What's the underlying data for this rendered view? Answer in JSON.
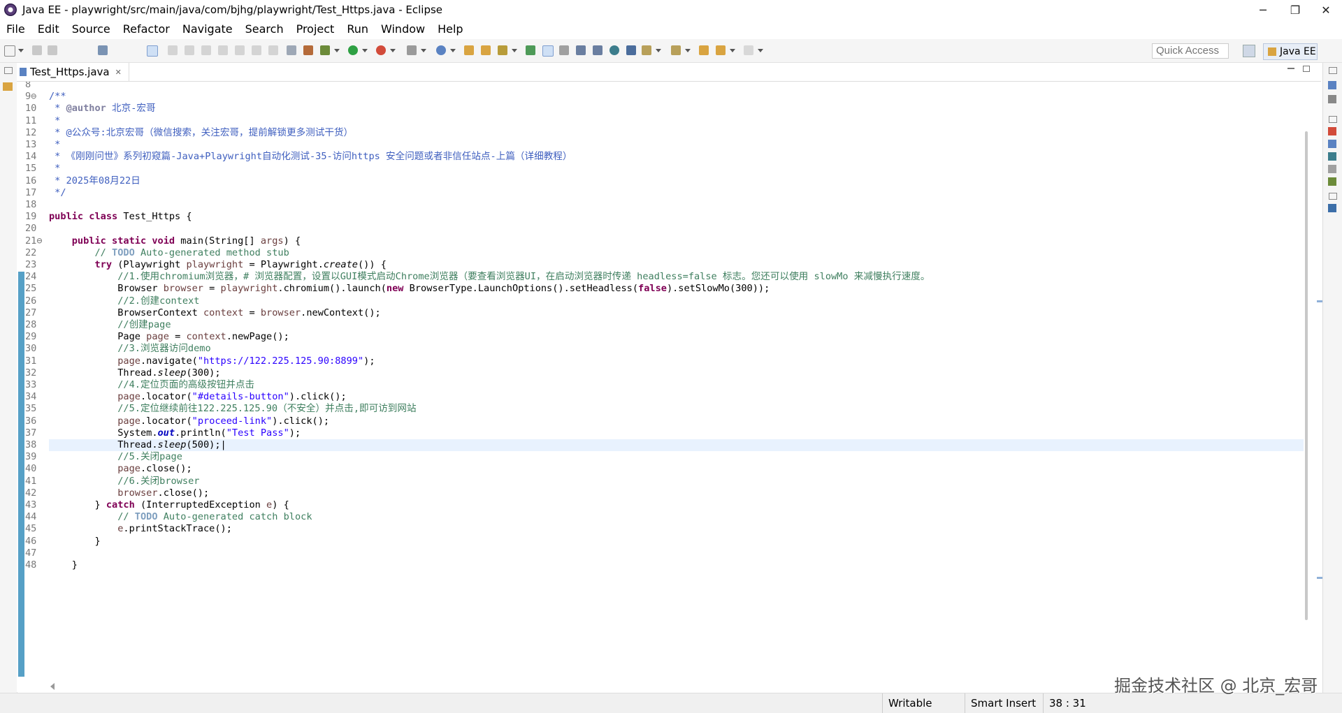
{
  "window": {
    "title": "Java EE - playwright/src/main/java/com/bjhg/playwright/Test_Https.java - Eclipse",
    "minimize_glyph": "─",
    "restore_glyph": "❐",
    "close_glyph": "✕"
  },
  "menu": [
    "File",
    "Edit",
    "Source",
    "Refactor",
    "Navigate",
    "Search",
    "Project",
    "Run",
    "Window",
    "Help"
  ],
  "toolbar": {
    "quick_access_placeholder": "Quick Access",
    "perspective_label": "Java EE"
  },
  "editor_tab": {
    "label": "Test_Https.java",
    "close_glyph": "✕"
  },
  "code_lines": [
    {
      "n": "8",
      "html": ""
    },
    {
      "n": "9⊖",
      "html": "<span class='jd'>/**</span>"
    },
    {
      "n": "10",
      "html": "<span class='jd'> * <span class='ann'>@author</span> 北京-宏哥</span>"
    },
    {
      "n": "11",
      "html": "<span class='jd'> *</span>"
    },
    {
      "n": "12",
      "html": "<span class='jd'> * @公众号:北京宏哥（微信搜索，关注宏哥，提前解锁更多测试干货）</span>"
    },
    {
      "n": "13",
      "html": "<span class='jd'> *</span>"
    },
    {
      "n": "14",
      "html": "<span class='jd'> * 《刚刚问世》系列初窥篇-Java+Playwright自动化测试-35-访问https 安全问题或者非信任站点-上篇（详细教程）</span>"
    },
    {
      "n": "15",
      "html": "<span class='jd'> *</span>"
    },
    {
      "n": "16",
      "html": "<span class='jd'> * 2025年08月22日</span>"
    },
    {
      "n": "17",
      "html": "<span class='jd'> */</span>"
    },
    {
      "n": "18",
      "html": ""
    },
    {
      "n": "19",
      "html": "<span class='kw'>public class</span> Test_Https {"
    },
    {
      "n": "20",
      "html": ""
    },
    {
      "n": "21⊖",
      "html": "    <span class='kw'>public static void</span> main(String[] <span class='var'>args</span>) {"
    },
    {
      "n": "22",
      "html": "        <span class='cm'>// <span class='todo'>TODO</span> Auto-generated method stub</span>"
    },
    {
      "n": "23",
      "html": "        <span class='kw'>try</span> (Playwright <span class='var'>playwright</span> = Playwright.<span class='it'>create</span>()) {"
    },
    {
      "n": "24",
      "html": "            <span class='cm'>//1.使用chromium浏览器，# 浏览器配置，设置以GUI模式启动Chrome浏览器（要查看浏览器UI，在启动浏览器时传递 headless=false 标志。您还可以使用 slowMo 来减慢执行速度。</span>"
    },
    {
      "n": "25",
      "html": "            Browser <span class='var'>browser</span> = <span class='var'>playwright</span>.chromium().launch(<span class='kw'>new</span> BrowserType.LaunchOptions().setHeadless(<span class='kw'>false</span>).setSlowMo(300));"
    },
    {
      "n": "26",
      "html": "            <span class='cm'>//2.创建context</span>"
    },
    {
      "n": "27",
      "html": "            BrowserContext <span class='var'>context</span> = <span class='var'>browser</span>.newContext();"
    },
    {
      "n": "28",
      "html": "            <span class='cm'>//创建page</span>"
    },
    {
      "n": "29",
      "html": "            Page <span class='var'>page</span> = <span class='var'>context</span>.newPage();"
    },
    {
      "n": "30",
      "html": "            <span class='cm'>//3.浏览器访问demo</span>"
    },
    {
      "n": "31",
      "html": "            <span class='var'>page</span>.navigate(<span class='st'>\"https://122.225.125.90:8899\"</span>);"
    },
    {
      "n": "32",
      "html": "            Thread.<span class='it'>sleep</span>(300);"
    },
    {
      "n": "33",
      "html": "            <span class='cm'>//4.定位页面的高级按钮并点击</span>"
    },
    {
      "n": "34",
      "html": "            <span class='var'>page</span>.locator(<span class='st'>\"#details-button\"</span>).click();"
    },
    {
      "n": "35",
      "html": "            <span class='cm'>//5.定位继续前往122.225.125.90（不安全）并点击,即可访到网站</span>"
    },
    {
      "n": "36",
      "html": "            <span class='var'>page</span>.locator(<span class='st'>\"proceed-link\"</span>).click();"
    },
    {
      "n": "37",
      "html": "            System.<span class='fld'>out</span>.println(<span class='st'>\"Test Pass\"</span>);"
    },
    {
      "n": "38",
      "html": "            Thread.<span class='it'>sleep</span>(500);|"
    },
    {
      "n": "39",
      "html": "            <span class='cm'>//5.关闭page</span>"
    },
    {
      "n": "40",
      "html": "            <span class='var'>page</span>.close();"
    },
    {
      "n": "41",
      "html": "            <span class='cm'>//6.关闭browser</span>"
    },
    {
      "n": "42",
      "html": "            <span class='var'>browser</span>.close();"
    },
    {
      "n": "43",
      "html": "        } <span class='kw'>catch</span> (InterruptedException <span class='var'>e</span>) {"
    },
    {
      "n": "44",
      "html": "            <span class='cm'>// <span class='todo'>TODO</span> Auto-generated catch block</span>"
    },
    {
      "n": "45",
      "html": "            <span class='var'>e</span>.printStackTrace();"
    },
    {
      "n": "46",
      "html": "        }"
    },
    {
      "n": "47",
      "html": ""
    },
    {
      "n": "48",
      "html": "    }"
    }
  ],
  "status": {
    "writable": "Writable",
    "insert_mode": "Smart Insert",
    "position": "38 : 31"
  },
  "watermark": "掘金技术社区 @ 北京_宏哥",
  "colors": {
    "keyword": "#7f0055",
    "comment": "#3f7f5f",
    "javadoc": "#3f5fbf",
    "string": "#2a00ff",
    "change_bar": "#56a0c6",
    "current_line": "#e8f2fe"
  }
}
